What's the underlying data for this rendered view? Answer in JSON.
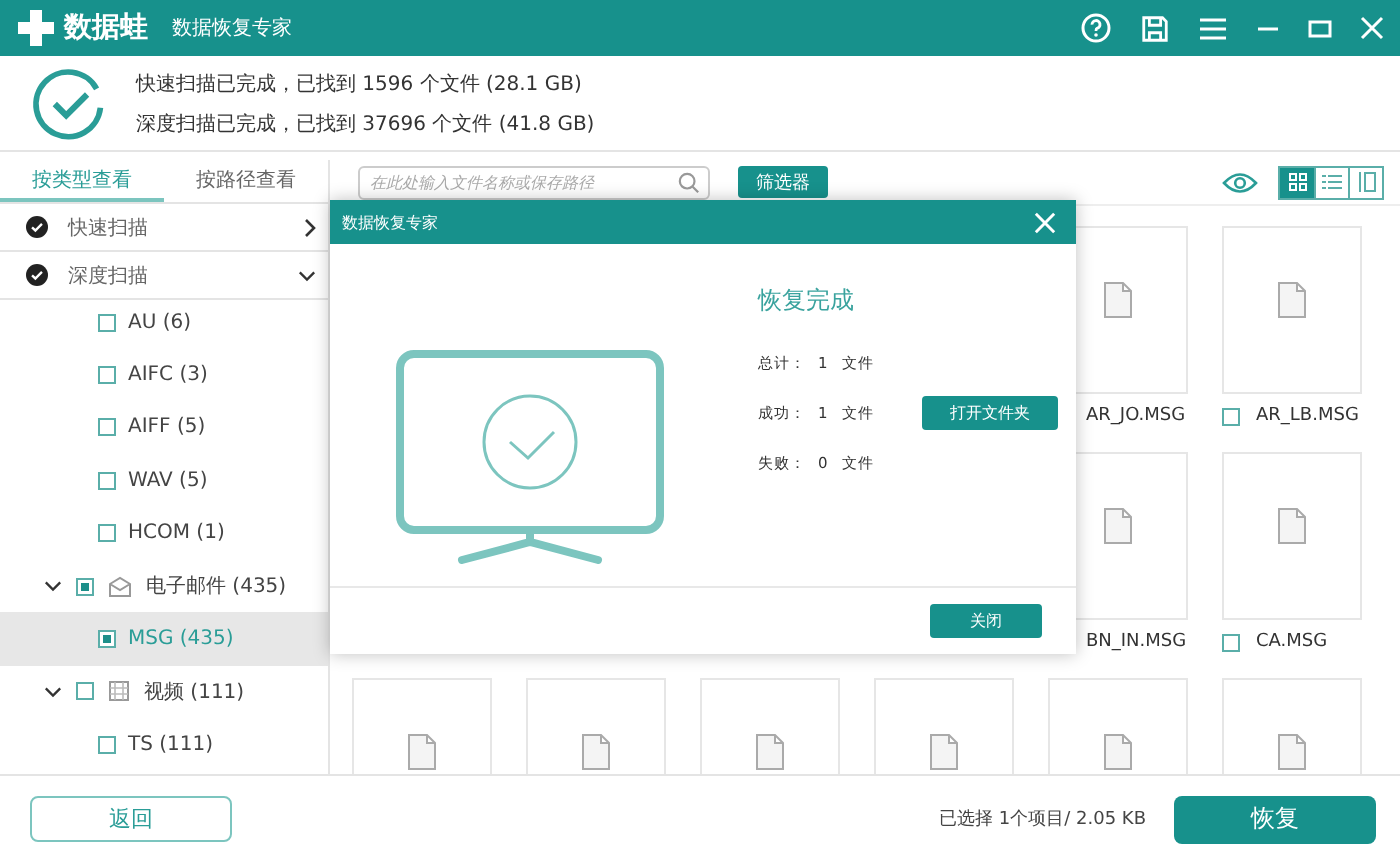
{
  "window": {
    "logo": "数据蛙",
    "title": "数据恢复专家"
  },
  "scan_summary": [
    "快速扫描已完成，已找到 1596 个文件 (28.1 GB)",
    "深度扫描已完成，已找到 37696 个文件 (41.8 GB)"
  ],
  "sidebar": {
    "tabs": [
      {
        "label": "按类型查看",
        "selected": true
      },
      {
        "label": "按路径查看",
        "selected": false
      }
    ],
    "scans": [
      {
        "label": "快速扫描",
        "expanded": false
      },
      {
        "label": "深度扫描",
        "expanded": true
      }
    ],
    "tree": [
      {
        "kind": "leaf",
        "label": "AU (6)",
        "checked": false,
        "selected": false
      },
      {
        "kind": "leaf",
        "label": "AIFC (3)",
        "checked": false,
        "selected": false
      },
      {
        "kind": "leaf",
        "label": "AIFF (5)",
        "checked": false,
        "selected": false
      },
      {
        "kind": "leaf",
        "label": "WAV (5)",
        "checked": false,
        "selected": false
      },
      {
        "kind": "leaf",
        "label": "HCOM (1)",
        "checked": false,
        "selected": false
      },
      {
        "kind": "email",
        "label": "电子邮件 (435)",
        "checked": true,
        "expanded": true,
        "children": [
          {
            "kind": "leaf",
            "label": "MSG (435)",
            "checked": true,
            "selected": true
          }
        ]
      },
      {
        "kind": "video",
        "label": "视频 (111)",
        "checked": false,
        "expanded": true,
        "children": [
          {
            "kind": "leaf",
            "label": "TS (111)",
            "checked": false,
            "selected": false
          }
        ]
      }
    ]
  },
  "toolbar": {
    "search": {
      "placeholder": "在此处输入文件名称或保存路径"
    },
    "filter_button": "筛选器",
    "views": [
      {
        "kind": "grid",
        "selected": true
      },
      {
        "kind": "list",
        "selected": false
      },
      {
        "kind": "columns",
        "selected": false
      }
    ]
  },
  "file_rows": [
    {
      "files": [
        {
          "name": "AR_JO.MSG"
        },
        {
          "name": "AR_LB.MSG",
          "checked": false
        }
      ]
    },
    {
      "files": [
        {
          "name": "BN_IN.MSG"
        },
        {
          "name": "CA.MSG",
          "checked": false
        }
      ]
    },
    {
      "files": [
        {
          "kind": "file"
        },
        {
          "kind": "file"
        },
        {
          "kind": "file"
        },
        {
          "kind": "file"
        },
        {
          "kind": "file"
        },
        {
          "kind": "file"
        }
      ]
    }
  ],
  "dialog": {
    "title": "数据恢复专家",
    "heading": "恢复完成",
    "stats": [
      {
        "label": "总计：",
        "count": "1",
        "unit": "文件"
      },
      {
        "label": "成功：",
        "count": "1",
        "unit": "文件"
      },
      {
        "label": "失败：",
        "count": "0",
        "unit": "文件"
      }
    ],
    "open_button": "打开文件夹",
    "close_button": "关闭"
  },
  "footer": {
    "back_button": "返回",
    "selection": "已选择 1个项目/ 2.05 KB",
    "recover_button": "恢复"
  }
}
